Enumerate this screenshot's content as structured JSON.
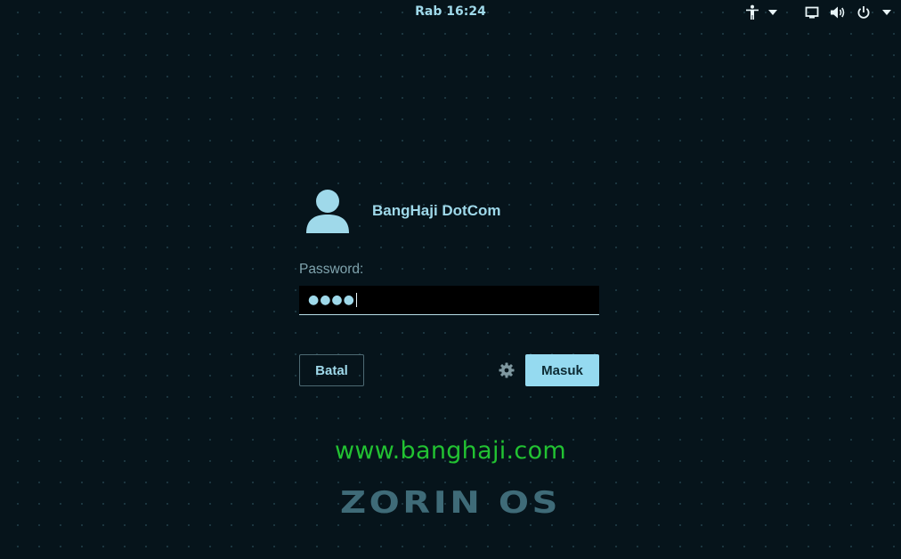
{
  "topbar": {
    "clock": "Rab 16:24",
    "icons": [
      "accessibility-icon",
      "dropdown-arrow-icon",
      "display-icon",
      "volume-icon",
      "power-icon",
      "dropdown-arrow-icon"
    ]
  },
  "login": {
    "user_name": "BangHaji DotCom",
    "prompt_label": "Password:",
    "password_value": "●●●●",
    "cancel_label": "Batal",
    "login_label": "Masuk",
    "session_icon": "gear-icon"
  },
  "watermark": "www.banghaji.com",
  "distro_logo": "ZORIN OS",
  "colors": {
    "background": "#06141b",
    "accent": "#95daf0",
    "text": "#9fd9ea",
    "watermark": "#22c232",
    "logo": "#3f6b78"
  }
}
